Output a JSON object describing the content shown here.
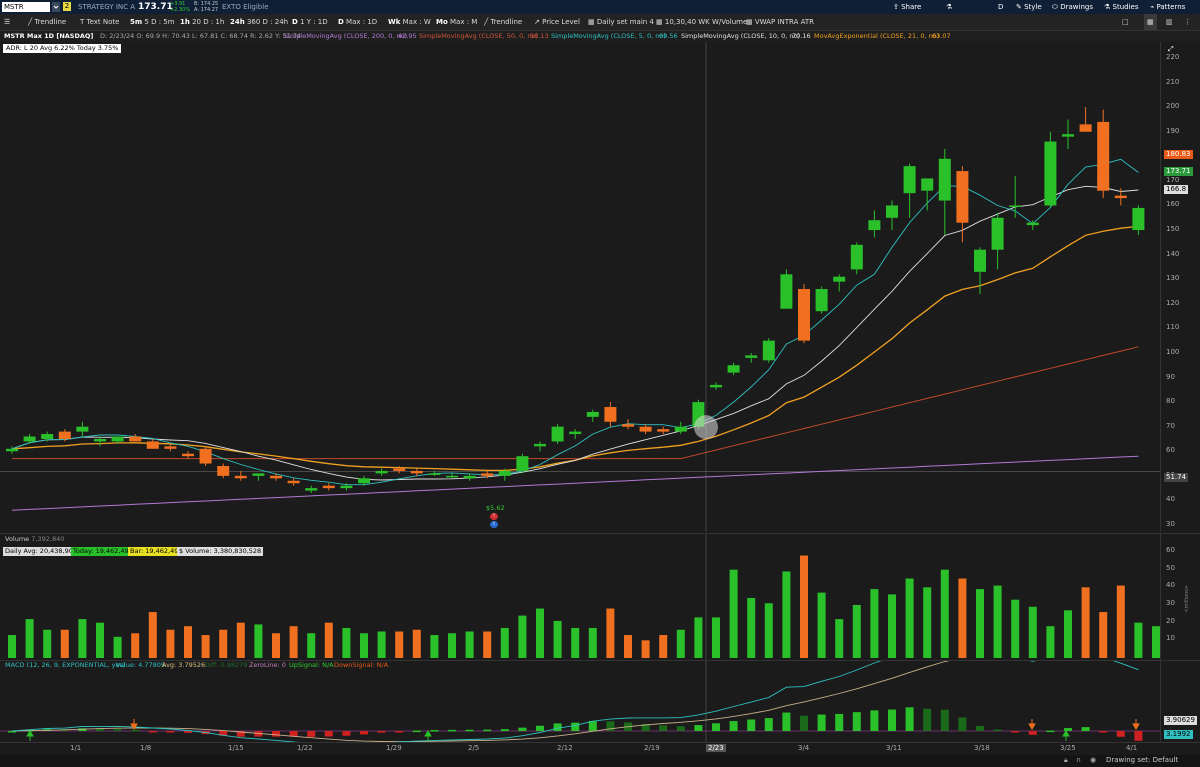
{
  "topbar": {
    "symbol": "MSTR",
    "badge": "2",
    "company": "STRATEGY INC A",
    "last": "173.71",
    "change": "+3.91",
    "change_pct": "+2.30%",
    "bid": "B: 174.25",
    "ask": "A: 174.27",
    "exto": "EXTO Eligible",
    "right_buttons": [
      "Share",
      "D",
      "Style",
      "Drawings",
      "Studies",
      "Patterns"
    ]
  },
  "toolbar": {
    "items": [
      "Trendline",
      "Text Note",
      "5m",
      "5 D : 5m",
      "1h",
      "20 D : 1h",
      "24h",
      "360 D : 24h",
      "D",
      "1 Y : 1D",
      "D",
      "Max : 1D",
      "Wk",
      "Max : W",
      "Mo",
      "Max : M",
      "Trendline",
      "Price Level",
      "Daily set main 4",
      "10,30,40 WK W/Volume",
      "VWAP INTRA ATR"
    ]
  },
  "studies": {
    "title": "MSTR Max 1D [NASDAQ]",
    "ohlc": "D: 2/23/24   O: 69.9   H: 70.43   L: 67.81   C: 68.74   R: 2.62   Y: 51.74",
    "sma200": "SimpleMovingAvg (CLOSE, 200, 0, no)",
    "sma200_val": "42.95",
    "sma50": "SimpleMovingAvg (CLOSE, 50, 0, no)",
    "sma50_val": "58.13",
    "sma5": "SimpleMovingAvg (CLOSE, 5, 0, no)",
    "sma5_val": "69.56",
    "sma10": "SimpleMovingAvg (CLOSE, 10, 0, no)",
    "sma10_val": "70.16",
    "ema21": "MovAvgExponential (CLOSE, 21, 0, no)",
    "ema21_val": "63.07",
    "adr": "ADR: L 20  Avg 6.22%  Today 3.75%"
  },
  "price_axis": {
    "ticks": [
      "220",
      "210",
      "200",
      "190",
      "180",
      "170",
      "160",
      "150",
      "140",
      "130",
      "120",
      "110",
      "100",
      "90",
      "80",
      "70",
      "60",
      "50",
      "40",
      "30"
    ],
    "box_last": "173.71",
    "box_orange": "180.83",
    "box_white": "166.8",
    "box_hline": "51.74"
  },
  "event": {
    "label": "$5.62"
  },
  "volume": {
    "label": "Volume",
    "value": "7,392,840",
    "daily_avg": "Daily Avg: 20,438,908",
    "today": "Today: 19,462,498",
    "bar": "Bar: 19,462,498",
    "dollar": "$ Volume: 3,380,830,528",
    "ticks": [
      "60",
      "50",
      "40",
      "30",
      "20",
      "10"
    ],
    "unit": "<millions>"
  },
  "macd": {
    "label": "MACD (12, 26, 9, EXPONENTIAL, yes)",
    "value": "Value: 4.77805",
    "avg": "Avg: 3.79526",
    "diff": "Diff: 0.98279",
    "zero": "ZeroLine: 0",
    "up": "UpSignal: N/A",
    "down": "DownSignal: N/A",
    "box1": "3.90629",
    "box2": "3.1992"
  },
  "xaxis": {
    "ticks": [
      "1/1",
      "1/8",
      "1/15",
      "1/22",
      "1/29",
      "2/5",
      "2/12",
      "2/19",
      "2/23",
      "3/4",
      "3/11",
      "3/18",
      "3/25",
      "4/1"
    ]
  },
  "status": {
    "drawing_set": "Drawing set: Default"
  },
  "chart_data": {
    "type": "candlestick",
    "title": "MSTR Max 1D [NASDAQ]",
    "candles": [
      {
        "o": 60,
        "h": 62,
        "l": 59,
        "c": 61
      },
      {
        "o": 64,
        "h": 67,
        "l": 63,
        "c": 66
      },
      {
        "o": 65,
        "h": 68,
        "l": 64,
        "c": 67
      },
      {
        "o": 68,
        "h": 69,
        "l": 64,
        "c": 65
      },
      {
        "o": 68,
        "h": 72,
        "l": 66,
        "c": 70
      },
      {
        "o": 64,
        "h": 66,
        "l": 62,
        "c": 65
      },
      {
        "o": 64,
        "h": 66,
        "l": 63,
        "c": 66
      },
      {
        "o": 66,
        "h": 67,
        "l": 64,
        "c": 64
      },
      {
        "o": 64,
        "h": 65,
        "l": 61,
        "c": 61
      },
      {
        "o": 62,
        "h": 63,
        "l": 60,
        "c": 61
      },
      {
        "o": 59,
        "h": 60,
        "l": 57,
        "c": 58
      },
      {
        "o": 61,
        "h": 62,
        "l": 54,
        "c": 55
      },
      {
        "o": 54,
        "h": 55,
        "l": 49,
        "c": 50
      },
      {
        "o": 50,
        "h": 52,
        "l": 48,
        "c": 49
      },
      {
        "o": 50,
        "h": 51,
        "l": 48,
        "c": 51
      },
      {
        "o": 50,
        "h": 51,
        "l": 48,
        "c": 49
      },
      {
        "o": 48,
        "h": 49,
        "l": 46,
        "c": 47
      },
      {
        "o": 44,
        "h": 46,
        "l": 43,
        "c": 45
      },
      {
        "o": 46,
        "h": 47,
        "l": 44,
        "c": 45
      },
      {
        "o": 45,
        "h": 47,
        "l": 44,
        "c": 46
      },
      {
        "o": 47,
        "h": 50,
        "l": 46,
        "c": 49
      },
      {
        "o": 51,
        "h": 53,
        "l": 50,
        "c": 52
      },
      {
        "o": 53,
        "h": 54,
        "l": 51,
        "c": 52
      },
      {
        "o": 52,
        "h": 53,
        "l": 50,
        "c": 51
      },
      {
        "o": 51,
        "h": 52,
        "l": 50,
        "c": 51
      },
      {
        "o": 50,
        "h": 51,
        "l": 49,
        "c": 50
      },
      {
        "o": 49,
        "h": 51,
        "l": 48,
        "c": 50
      },
      {
        "o": 51,
        "h": 52,
        "l": 49,
        "c": 50
      },
      {
        "o": 50,
        "h": 53,
        "l": 48,
        "c": 52
      },
      {
        "o": 52,
        "h": 59,
        "l": 51,
        "c": 58
      },
      {
        "o": 62,
        "h": 64,
        "l": 60,
        "c": 63
      },
      {
        "o": 64,
        "h": 71,
        "l": 63,
        "c": 70
      },
      {
        "o": 67,
        "h": 69,
        "l": 65,
        "c": 68
      },
      {
        "o": 74,
        "h": 77,
        "l": 72,
        "c": 76
      },
      {
        "o": 78,
        "h": 80,
        "l": 70,
        "c": 72
      },
      {
        "o": 71,
        "h": 73,
        "l": 69,
        "c": 70
      },
      {
        "o": 70,
        "h": 71,
        "l": 67,
        "c": 68
      },
      {
        "o": 69,
        "h": 70,
        "l": 67,
        "c": 68
      },
      {
        "o": 68,
        "h": 72,
        "l": 67,
        "c": 70
      },
      {
        "o": 70,
        "h": 81,
        "l": 69,
        "c": 80
      },
      {
        "o": 86,
        "h": 88,
        "l": 85,
        "c": 87
      },
      {
        "o": 92,
        "h": 96,
        "l": 91,
        "c": 95
      },
      {
        "o": 98,
        "h": 100,
        "l": 96,
        "c": 99
      },
      {
        "o": 97,
        "h": 106,
        "l": 96,
        "c": 105
      },
      {
        "o": 118,
        "h": 134,
        "l": 118,
        "c": 132
      },
      {
        "o": 126,
        "h": 128,
        "l": 104,
        "c": 105
      },
      {
        "o": 117,
        "h": 127,
        "l": 116,
        "c": 126
      },
      {
        "o": 129,
        "h": 132,
        "l": 125,
        "c": 131
      },
      {
        "o": 134,
        "h": 145,
        "l": 132,
        "c": 144
      },
      {
        "o": 150,
        "h": 158,
        "l": 147,
        "c": 154
      },
      {
        "o": 155,
        "h": 162,
        "l": 150,
        "c": 160
      },
      {
        "o": 165,
        "h": 177,
        "l": 155,
        "c": 176
      },
      {
        "o": 166,
        "h": 171,
        "l": 158,
        "c": 171
      },
      {
        "o": 162,
        "h": 183,
        "l": 148,
        "c": 179
      },
      {
        "o": 174,
        "h": 176,
        "l": 145,
        "c": 153
      },
      {
        "o": 133,
        "h": 143,
        "l": 124,
        "c": 142
      },
      {
        "o": 142,
        "h": 157,
        "l": 134,
        "c": 155
      },
      {
        "o": 160,
        "h": 172,
        "l": 155,
        "c": 160
      },
      {
        "o": 152,
        "h": 154,
        "l": 150,
        "c": 153
      },
      {
        "o": 160,
        "h": 190,
        "l": 159,
        "c": 186
      },
      {
        "o": 188,
        "h": 195,
        "l": 183,
        "c": 189
      },
      {
        "o": 193,
        "h": 200,
        "l": 190,
        "c": 190
      },
      {
        "o": 194,
        "h": 199,
        "l": 163,
        "c": 166
      },
      {
        "o": 164,
        "h": 167,
        "l": 160,
        "c": 163
      },
      {
        "o": 150,
        "h": 160,
        "l": 148,
        "c": 159
      }
    ],
    "volumes_millions": [
      13,
      22,
      16,
      16,
      22,
      20,
      12,
      14,
      26,
      16,
      18,
      13,
      16,
      20,
      19,
      14,
      18,
      14,
      20,
      17,
      14,
      15,
      15,
      16,
      13,
      14,
      15,
      15,
      17,
      24,
      28,
      21,
      17,
      17,
      28,
      13,
      10,
      13,
      16,
      23,
      23,
      50,
      34,
      31,
      49,
      58,
      37,
      22,
      30,
      39,
      36,
      45,
      40,
      50,
      45,
      39,
      41,
      33,
      29,
      18,
      27,
      40,
      26,
      41,
      20,
      18
    ],
    "ylim": [
      25,
      225
    ],
    "xlabel": "",
    "ylabel": ""
  }
}
